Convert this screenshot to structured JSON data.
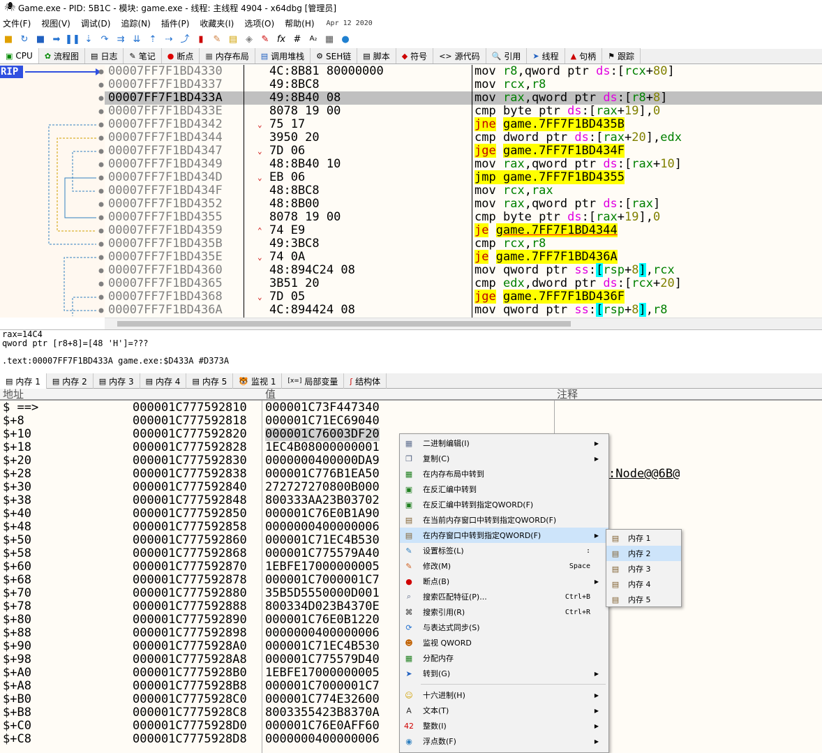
{
  "window": {
    "title": "Game.exe - PID: 5B1C - 模块: game.exe - 线程: 主线程 4904 - x64dbg [管理员]"
  },
  "menu": {
    "items": [
      "文件(F)",
      "视图(V)",
      "调试(D)",
      "追踪(N)",
      "插件(P)",
      "收藏夹(I)",
      "选项(O)",
      "帮助(H)"
    ],
    "date": "Apr 12 2020"
  },
  "tabs": [
    {
      "label": "CPU",
      "icon": "cpu-icon"
    },
    {
      "label": "流程图",
      "icon": "graph-icon"
    },
    {
      "label": "日志",
      "icon": "log-icon"
    },
    {
      "label": "笔记",
      "icon": "notes-icon"
    },
    {
      "label": "断点",
      "icon": "breakpoint-icon"
    },
    {
      "label": "内存布局",
      "icon": "memory-map-icon"
    },
    {
      "label": "调用堆栈",
      "icon": "call-stack-icon"
    },
    {
      "label": "SEH链",
      "icon": "seh-icon"
    },
    {
      "label": "脚本",
      "icon": "script-icon"
    },
    {
      "label": "符号",
      "icon": "symbols-icon"
    },
    {
      "label": "源代码",
      "icon": "source-icon"
    },
    {
      "label": "引用",
      "icon": "references-icon"
    },
    {
      "label": "线程",
      "icon": "threads-icon"
    },
    {
      "label": "句柄",
      "icon": "handles-icon"
    },
    {
      "label": "跟踪",
      "icon": "trace-icon"
    }
  ],
  "disasm": {
    "rip_label": "RIP",
    "lines": [
      {
        "addr": "00007FF7F1BD4330",
        "arrow": "",
        "bytes": "4C:8B81 80000000"
      },
      {
        "addr": "00007FF7F1BD4337",
        "arrow": "",
        "bytes": "49:8BC8"
      },
      {
        "addr": "00007FF7F1BD433A",
        "arrow": "",
        "bytes": "49:8B40 08"
      },
      {
        "addr": "00007FF7F1BD433E",
        "arrow": "",
        "bytes": "8078 19 00"
      },
      {
        "addr": "00007FF7F1BD4342",
        "arrow": "⌄",
        "bytes": "75 17"
      },
      {
        "addr": "00007FF7F1BD4344",
        "arrow": "",
        "bytes": "3950 20"
      },
      {
        "addr": "00007FF7F1BD4347",
        "arrow": "⌄",
        "bytes": "7D 06"
      },
      {
        "addr": "00007FF7F1BD4349",
        "arrow": "",
        "bytes": "48:8B40 10"
      },
      {
        "addr": "00007FF7F1BD434D",
        "arrow": "⌄",
        "bytes": "EB 06"
      },
      {
        "addr": "00007FF7F1BD434F",
        "arrow": "",
        "bytes": "48:8BC8"
      },
      {
        "addr": "00007FF7F1BD4352",
        "arrow": "",
        "bytes": "48:8B00"
      },
      {
        "addr": "00007FF7F1BD4355",
        "arrow": "",
        "bytes": "8078 19 00"
      },
      {
        "addr": "00007FF7F1BD4359",
        "arrow": "⌃",
        "bytes": "74 E9"
      },
      {
        "addr": "00007FF7F1BD435B",
        "arrow": "",
        "bytes": "49:3BC8"
      },
      {
        "addr": "00007FF7F1BD435E",
        "arrow": "⌄",
        "bytes": "74 0A"
      },
      {
        "addr": "00007FF7F1BD4360",
        "arrow": "",
        "bytes": "48:894C24 08"
      },
      {
        "addr": "00007FF7F1BD4365",
        "arrow": "",
        "bytes": "3B51 20"
      },
      {
        "addr": "00007FF7F1BD4368",
        "arrow": "⌄",
        "bytes": "7D 05"
      },
      {
        "addr": "00007FF7F1BD436A",
        "arrow": "",
        "bytes": "4C:894424 08"
      }
    ]
  },
  "info": {
    "line1": "rax=14C4",
    "line2": "qword ptr [r8+8]=[48 'H']=???",
    "line3": ".text:00007FF7F1BD433A game.exe:$D433A #D373A"
  },
  "bottom_tabs": [
    {
      "label": "内存 1",
      "icon": "memory-icon"
    },
    {
      "label": "内存 2",
      "icon": "memory-icon"
    },
    {
      "label": "内存 3",
      "icon": "memory-icon"
    },
    {
      "label": "内存 4",
      "icon": "memory-icon"
    },
    {
      "label": "内存 5",
      "icon": "memory-icon"
    },
    {
      "label": "监视 1",
      "icon": "watch-icon"
    },
    {
      "label": "局部变量",
      "icon": "locals-icon"
    },
    {
      "label": "结构体",
      "icon": "struct-icon"
    }
  ],
  "dump": {
    "headers": [
      "地址",
      "值",
      "注释"
    ],
    "note_fragment": ":Node@@6B@",
    "rows": [
      [
        "$ ==>",
        "000001C777592810",
        "000001C73F447340"
      ],
      [
        "$+8",
        "000001C777592818",
        "000001C71EC69040"
      ],
      [
        "$+10",
        "000001C777592820",
        "000001C76003DF20"
      ],
      [
        "$+18",
        "000001C777592828",
        "1EC4B08000000001"
      ],
      [
        "$+20",
        "000001C777592830",
        "0000000400000DA9"
      ],
      [
        "$+28",
        "000001C777592838",
        "000001C776B1EA50"
      ],
      [
        "$+30",
        "000001C777592840",
        "272727270800B000"
      ],
      [
        "$+38",
        "000001C777592848",
        "800333AA23B03702"
      ],
      [
        "$+40",
        "000001C777592850",
        "000001C76E0B1A90"
      ],
      [
        "$+48",
        "000001C777592858",
        "0000000400000006"
      ],
      [
        "$+50",
        "000001C777592860",
        "000001C71EC4B530"
      ],
      [
        "$+58",
        "000001C777592868",
        "000001C775579A40"
      ],
      [
        "$+60",
        "000001C777592870",
        "1EBFE17000000005"
      ],
      [
        "$+68",
        "000001C777592878",
        "000001C7000001C7"
      ],
      [
        "$+70",
        "000001C777592880",
        "35B5D5550000D001"
      ],
      [
        "$+78",
        "000001C777592888",
        "800334D023B4370E"
      ],
      [
        "$+80",
        "000001C777592890",
        "000001C76E0B1220"
      ],
      [
        "$+88",
        "000001C777592898",
        "0000000400000006"
      ],
      [
        "$+90",
        "000001C7775928A0",
        "000001C71EC4B530"
      ],
      [
        "$+98",
        "000001C7775928A8",
        "000001C775579D40"
      ],
      [
        "$+A0",
        "000001C7775928B0",
        "1EBFE17000000005"
      ],
      [
        "$+A8",
        "000001C7775928B8",
        "000001C7000001C7"
      ],
      [
        "$+B0",
        "000001C7775928C0",
        "000001C774E32600"
      ],
      [
        "$+B8",
        "000001C7775928C8",
        "8003355423B8370A"
      ],
      [
        "$+C0",
        "000001C7775928D0",
        "000001C76E0AFF60"
      ],
      [
        "$+C8",
        "000001C7775928D8",
        "0000000400000006"
      ]
    ]
  },
  "context_menu": {
    "items": [
      {
        "label": "二进制编辑(I)",
        "icon": "binary-edit-icon",
        "shortcut": "",
        "submenu": true
      },
      {
        "label": "复制(C)",
        "icon": "copy-icon",
        "shortcut": "",
        "submenu": true
      },
      {
        "label": "在内存布局中转到",
        "icon": "memory-map-icon",
        "shortcut": "",
        "submenu": false
      },
      {
        "label": "在反汇编中转到",
        "icon": "disasm-icon",
        "shortcut": "",
        "submenu": false
      },
      {
        "label": "在反汇编中转到指定QWORD(F)",
        "icon": "disasm-icon",
        "shortcut": "",
        "submenu": false
      },
      {
        "label": "在当前内存窗口中转到指定QWORD(F)",
        "icon": "memory-icon",
        "shortcut": "",
        "submenu": false
      },
      {
        "label": "在内存窗口中转到指定QWORD(F)",
        "icon": "memory-icon",
        "shortcut": "",
        "submenu": true
      },
      {
        "label": "设置标签(L)",
        "icon": "label-icon",
        "shortcut": ":",
        "submenu": false
      },
      {
        "label": "修改(M)",
        "icon": "edit-icon",
        "shortcut": "Space",
        "submenu": false
      },
      {
        "label": "断点(B)",
        "icon": "breakpoint-icon",
        "shortcut": "",
        "submenu": true
      },
      {
        "label": "搜索匹配特征(P)...",
        "icon": "search-pattern-icon",
        "shortcut": "Ctrl+B",
        "submenu": false
      },
      {
        "label": "搜索引用(R)",
        "icon": "binoculars-icon",
        "shortcut": "Ctrl+R",
        "submenu": false
      },
      {
        "label": "与表达式同步(S)",
        "icon": "sync-icon",
        "shortcut": "",
        "submenu": false
      },
      {
        "label": "监视 QWORD",
        "icon": "watch-icon",
        "shortcut": "",
        "submenu": false
      },
      {
        "label": "分配内存",
        "icon": "alloc-icon",
        "shortcut": "",
        "submenu": false
      },
      {
        "label": "转到(G)",
        "icon": "goto-icon",
        "shortcut": "",
        "submenu": true
      },
      {
        "label": "十六进制(H)",
        "icon": "hex-icon",
        "shortcut": "",
        "submenu": true
      },
      {
        "label": "文本(T)",
        "icon": "text-icon",
        "shortcut": "",
        "submenu": true
      },
      {
        "label": "整数(I)",
        "icon": "integer-icon",
        "shortcut": "",
        "submenu": true
      },
      {
        "label": "浮点数(F)",
        "icon": "float-icon",
        "shortcut": "",
        "submenu": true
      }
    ]
  },
  "submenu": {
    "items": [
      "内存 1",
      "内存 2",
      "内存 3",
      "内存 4",
      "内存 5"
    ]
  },
  "colors": {
    "rip_bg": "#3050e0",
    "selected_row": "#c0c0c0",
    "jump_highlight": "#ffff00",
    "hover": "#cde4fa"
  }
}
